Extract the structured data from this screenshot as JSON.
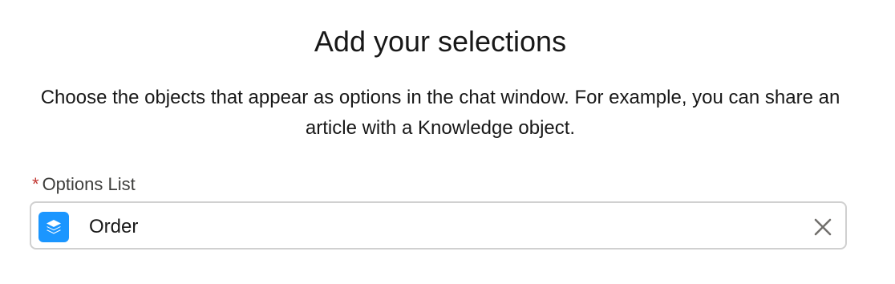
{
  "header": {
    "title": "Add your selections",
    "description": "Choose the objects that appear as options in the chat window. For example, you can share an article with a Knowledge object."
  },
  "field": {
    "required_marker": "*",
    "label": "Options List",
    "selected_value": "Order",
    "selected_icon": "stacked-layers-icon",
    "clear_icon": "close-icon"
  },
  "colors": {
    "icon_background": "#1b96ff",
    "required": "#c23934",
    "border": "#d0d0d0"
  }
}
